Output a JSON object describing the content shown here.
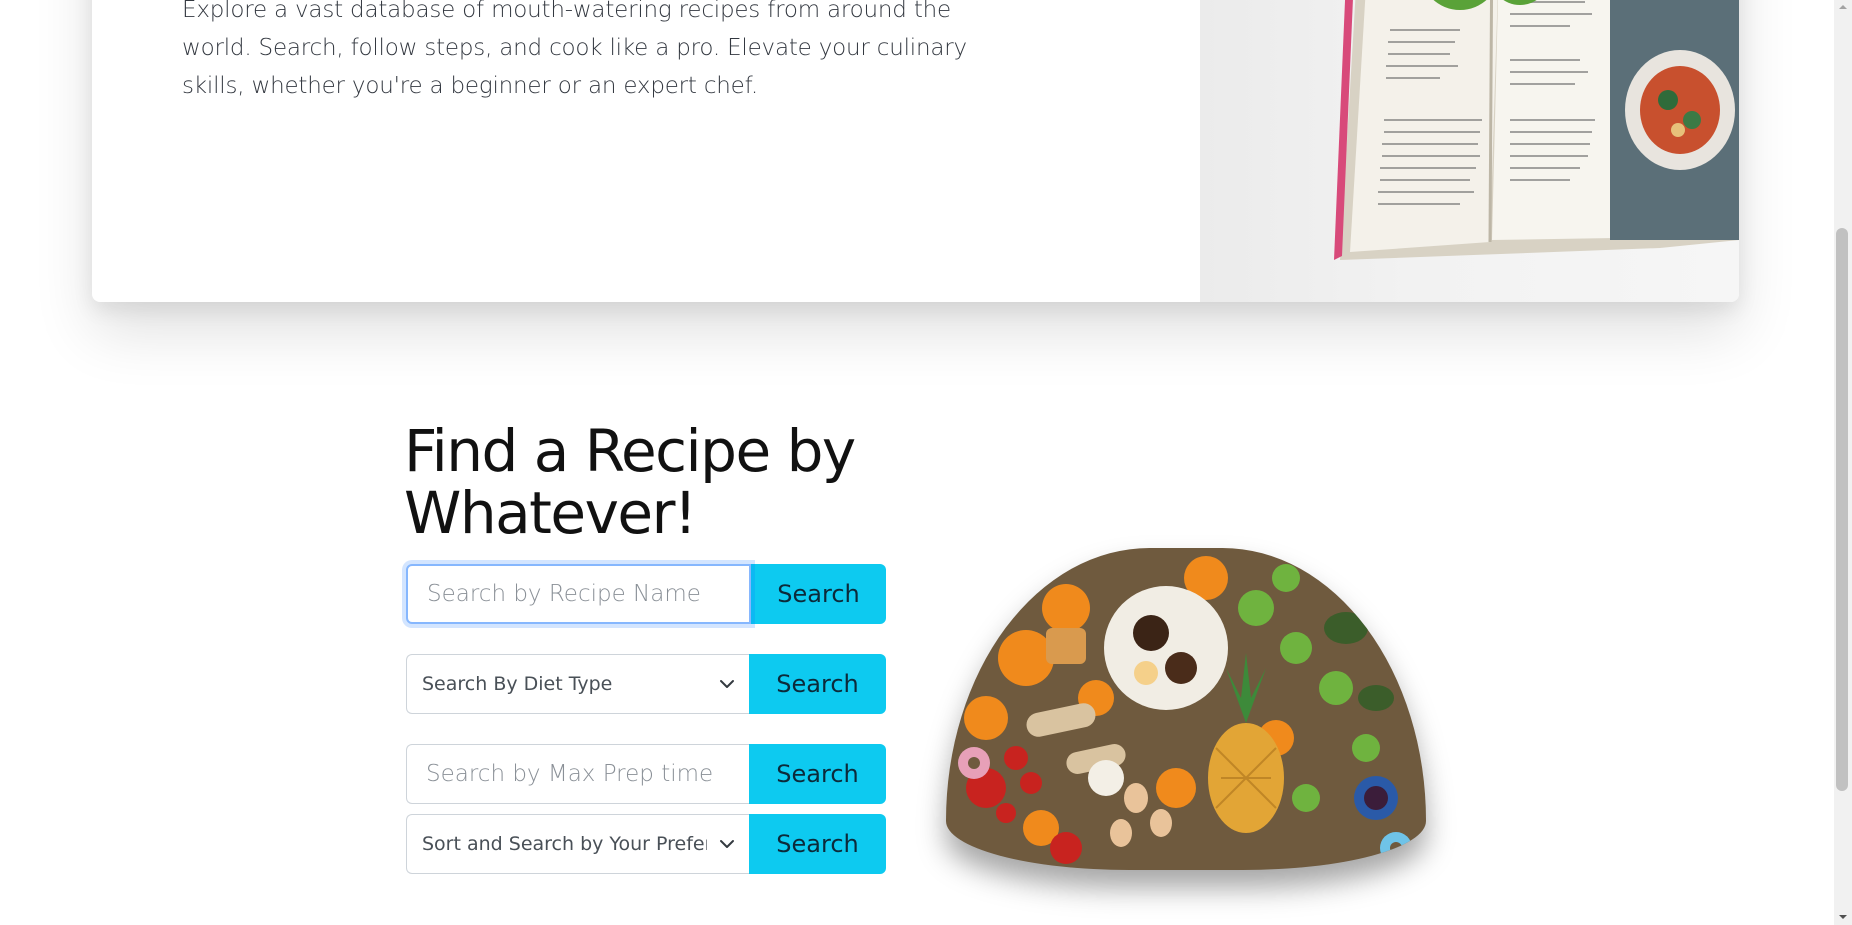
{
  "hero": {
    "intro_text": "Explore a vast database of mouth-watering recipes from around the world. Search, follow steps, and cook like a pro. Elevate your culinary skills, whether you're a beginner or an expert chef.",
    "image_icon": "cookbook-with-lettuce-image"
  },
  "finder": {
    "title": "Find a Recipe by Whatever!",
    "recipe_name": {
      "placeholder": "Search by Recipe Name",
      "button": "Search"
    },
    "diet_type": {
      "selected": "Search By Diet Type",
      "button": "Search"
    },
    "max_prep": {
      "placeholder": "Search by Max Prep time",
      "button": "Search"
    },
    "preference": {
      "selected": "Sort and Search by Your Preferences",
      "button": "Search"
    },
    "image_icon": "assorted-food-dome-image"
  },
  "colors": {
    "accent": "#0dcaf0",
    "focus_ring": "#86b7fe",
    "text": "#212529"
  }
}
